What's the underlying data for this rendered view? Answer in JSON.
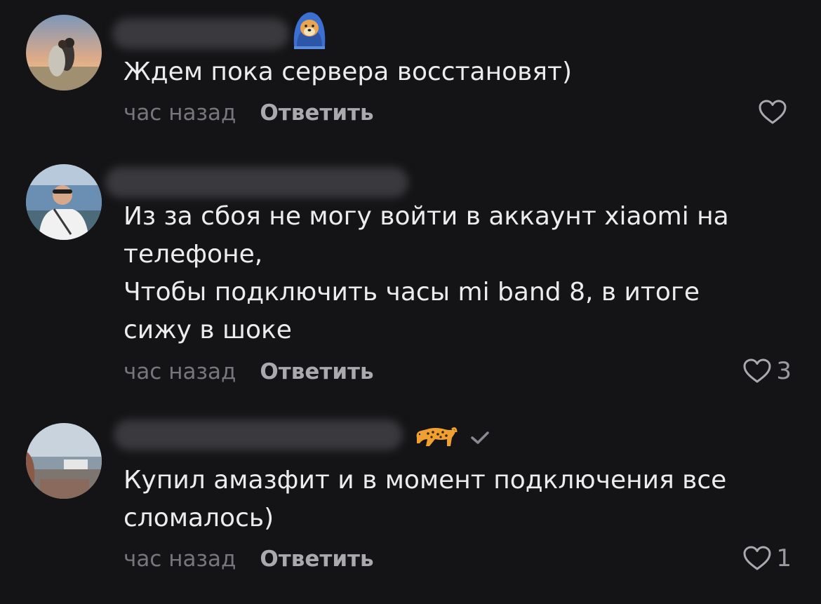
{
  "comments": [
    {
      "text": "Ждем пока сервера восстановят)",
      "time": "час назад",
      "reply_label": "Ответить",
      "like_count": ""
    },
    {
      "text": "Из за сбоя не могу войти в аккаунт xiaomi на\nтелефоне,\nЧтобы подключить часы mi band 8, в итоге\nсижу в шоке",
      "time": "час назад",
      "reply_label": "Ответить",
      "like_count": "3"
    },
    {
      "text": "Купил амазфит и в момент подключения все\nсломалось)",
      "time": "час назад",
      "reply_label": "Ответить",
      "like_count": "1"
    }
  ],
  "colors": {
    "background": "#141416",
    "text": "#ececee",
    "muted": "#76767b",
    "reply": "#a9a9ae"
  },
  "icons": {
    "badge_1": "dog-in-blanket-icon",
    "badge_3": "leopard-icon",
    "verified": "check-icon",
    "like": "heart-outline-icon"
  }
}
